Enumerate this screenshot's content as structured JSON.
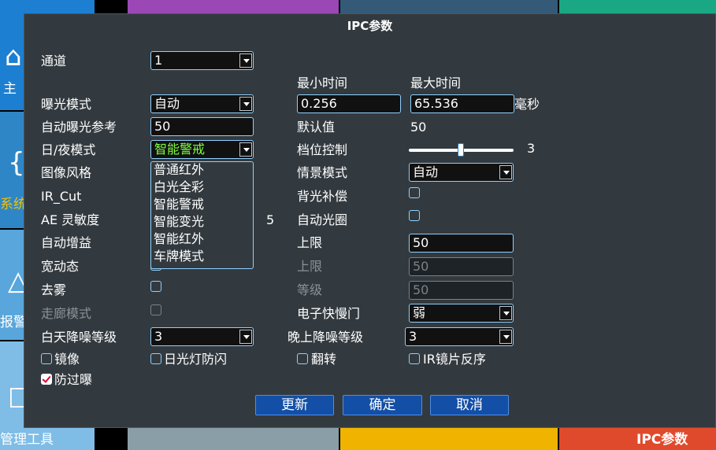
{
  "background": {
    "tile1_text": "主",
    "tile2_text": "系统",
    "tile3_text": "报警",
    "tile4_text": "管理工具",
    "tile_bottom_right_text": "IPC参数"
  },
  "dialog": {
    "title": "IPC参数",
    "channel": {
      "label": "通道",
      "value": "1"
    },
    "time_headers": {
      "min": "最小时间",
      "max": "最大时间"
    },
    "exposure_mode": {
      "label": "曝光模式",
      "value": "自动"
    },
    "min_time": "0.256",
    "max_time": "65.536",
    "unit_ms": "毫秒",
    "auto_exposure_ref": {
      "label": "自动曝光参考",
      "value": "50"
    },
    "default_value": {
      "label": "默认值",
      "value": "50"
    },
    "day_night_mode": {
      "label": "日/夜模式",
      "value": "智能警戒",
      "options": [
        "普通红外",
        "白光全彩",
        "智能警戒",
        "智能变光",
        "智能红外",
        "车牌模式"
      ]
    },
    "gear_control": {
      "label": "档位控制",
      "value": "3",
      "level_fraction": 0.5
    },
    "image_style": {
      "label": "图像风格"
    },
    "scene_mode": {
      "label": "情景模式",
      "value": "自动"
    },
    "ir_cut": {
      "label": "IR_Cut"
    },
    "backlight_comp": {
      "label": "背光补偿"
    },
    "ae_sensitivity": {
      "label": "AE 灵敏度",
      "value": "5"
    },
    "auto_iris": {
      "label": "自动光圈"
    },
    "auto_gain": {
      "label": "自动增益"
    },
    "upper_limit_1": {
      "label": "上限",
      "value": "50"
    },
    "wdr": {
      "label": "宽动态"
    },
    "upper_limit_2": {
      "label": "上限",
      "value": "50"
    },
    "defog": {
      "label": "去雾"
    },
    "level": {
      "label": "等级",
      "value": "50"
    },
    "corridor_mode": {
      "label": "走廊模式"
    },
    "electronic_shutter": {
      "label": "电子快慢门",
      "value": "弱"
    },
    "day_nr": {
      "label": "白天降噪等级",
      "value": "3"
    },
    "night_nr": {
      "label": "晚上降噪等级",
      "value": "3"
    },
    "mirror": {
      "label": "镜像"
    },
    "anti_flicker": {
      "label": "日光灯防闪"
    },
    "flip": {
      "label": "翻转"
    },
    "ir_reverse": {
      "label": "IR镜片反序"
    },
    "anti_overexposure": {
      "label": "防过曝"
    },
    "buttons": {
      "refresh": "更新",
      "ok": "确定",
      "cancel": "取消"
    }
  }
}
